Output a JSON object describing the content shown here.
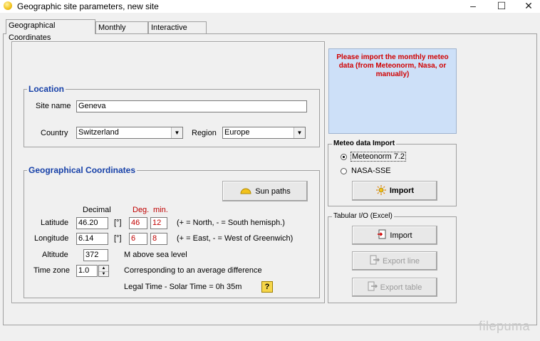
{
  "window": {
    "title": "Geographic site parameters, new site"
  },
  "tabs": [
    {
      "label": "Geographical Coordinates"
    },
    {
      "label": "Monthly meteo"
    },
    {
      "label": "Interactive Map"
    }
  ],
  "location": {
    "group_title": "Location",
    "site_name_label": "Site name",
    "site_name_value": "Geneva",
    "country_label": "Country",
    "country_value": "Switzerland",
    "region_label": "Region",
    "region_value": "Europe"
  },
  "geo": {
    "group_title": "Geographical Coordinates",
    "sun_paths_label": "Sun paths",
    "col_decimal": "Decimal",
    "col_deg": "Deg.",
    "col_min": "min.",
    "latitude_label": "Latitude",
    "latitude_decimal": "46.20",
    "latitude_unit": "[°]",
    "latitude_deg": "46",
    "latitude_min": "12",
    "latitude_note": "(+ = North,  - = South hemisph.)",
    "longitude_label": "Longitude",
    "longitude_decimal": "6.14",
    "longitude_unit": "[°]",
    "longitude_deg": "6",
    "longitude_min": "8",
    "longitude_note": "(+ = East, - = West of Greenwich)",
    "altitude_label": "Altitude",
    "altitude_value": "372",
    "altitude_note": "M above sea level",
    "timezone_label": "Time zone",
    "timezone_value": "1.0",
    "timezone_note": "Corresponding to an average difference",
    "legal_time_text": "Legal Time - Solar Time =   0h 35m",
    "help_label": "?"
  },
  "notice": {
    "text": "Please import the monthly meteo data (from Meteonorm, Nasa, or manually)"
  },
  "meteo_import": {
    "group_title": "Meteo data Import",
    "options": [
      {
        "label": "Meteonorm 7.2",
        "checked": true
      },
      {
        "label": "NASA-SSE",
        "checked": false
      }
    ],
    "import_label": "Import"
  },
  "tabular": {
    "group_title": "Tabular I/O (Excel)",
    "import_label": "Import",
    "export_line_label": "Export line",
    "export_table_label": "Export table"
  },
  "watermark": "filepuma",
  "colors": {
    "accent_blue": "#1640a8",
    "notice_bg": "#cde0f8",
    "notice_text": "#d10000",
    "dms_red": "#c00000"
  }
}
